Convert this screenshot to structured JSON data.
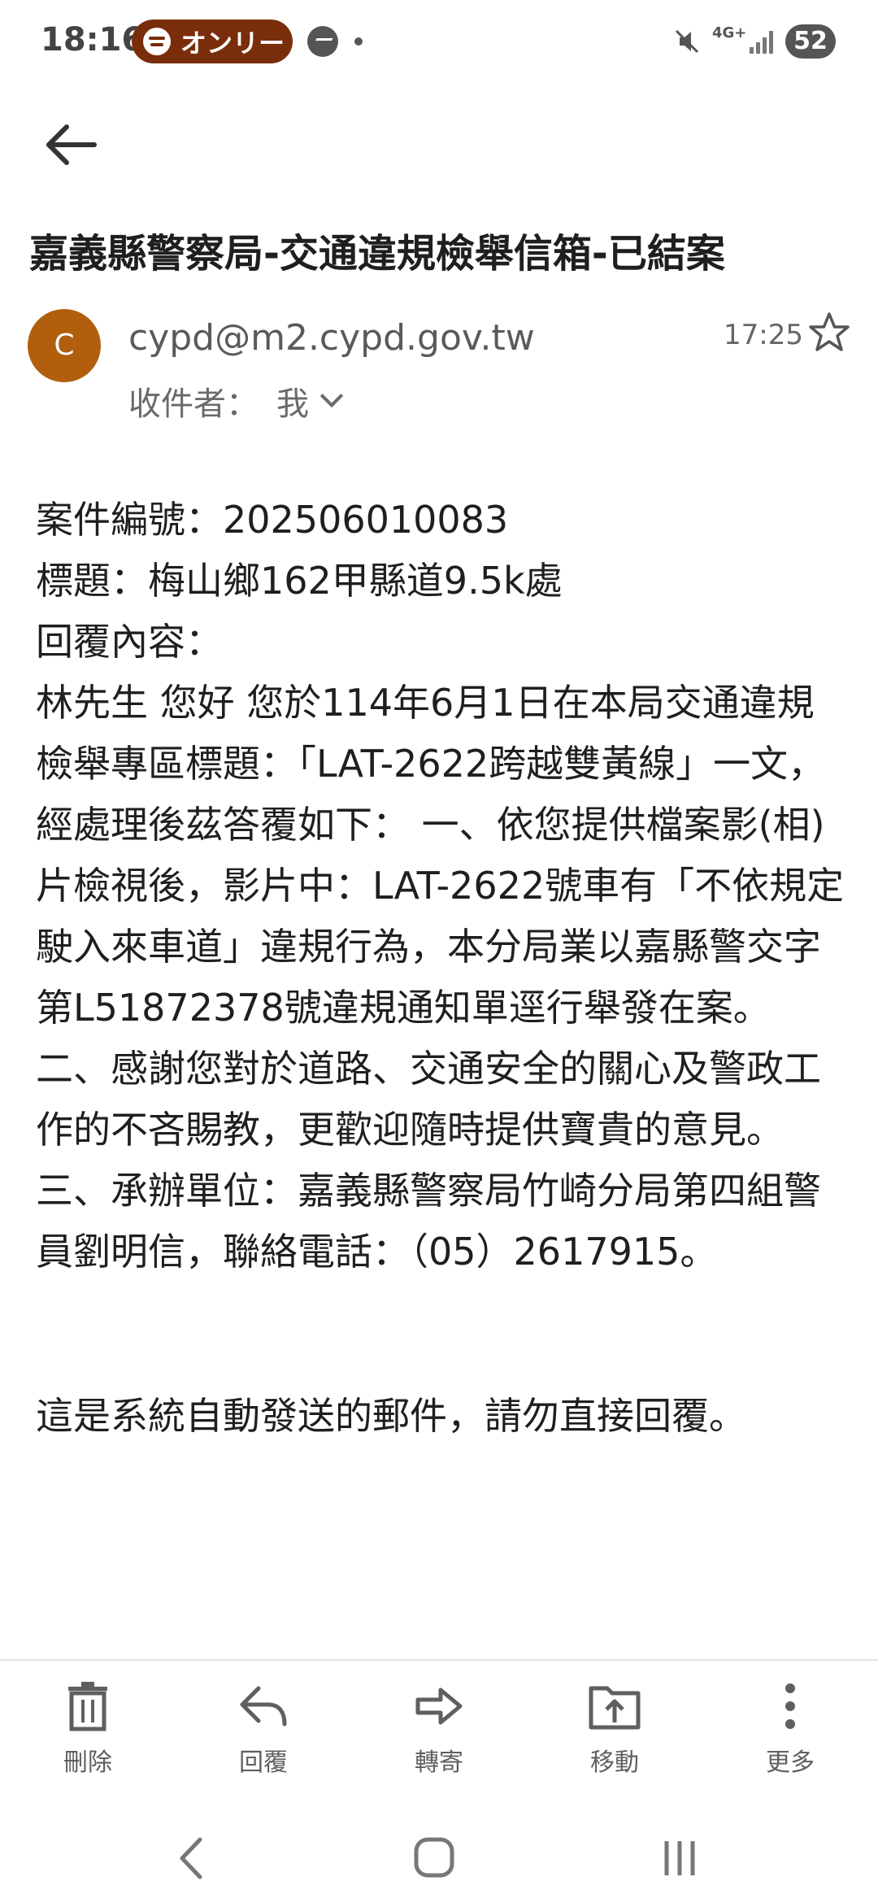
{
  "status_bar": {
    "time": "18:16",
    "spotify_label": "オンリー",
    "network": "4G+",
    "battery": "52"
  },
  "email": {
    "subject": "嘉義縣警察局-交通違規檢舉信箱-已結案",
    "avatar_letter": "C",
    "avatar_color": "#b15f0d",
    "sender": "cypd@m2.cypd.gov.tw",
    "recipient_label": "收件者：",
    "recipient": "我",
    "time": "17:25",
    "body_lines": [
      "案件編號：202506010083",
      "標題：梅山鄉162甲縣道9.5k處",
      "回覆內容：",
      "林先生 您好 您於114年6月1日在本局交通違規檢舉專區標題：「LAT-2622跨越雙黃線」一文，經處理後茲答覆如下： 一、依您提供檔案影(相)片檢視後，影片中：LAT-2622號車有「不依規定駛入來車道」違規行為，本分局業以嘉縣警交字第L51872378號違規通知單逕行舉發在案。 二、感謝您對於道路、交通安全的關心及警政工作的不吝賜教，更歡迎隨時提供寶貴的意見。 三、承辦單位：嘉義縣警察局竹崎分局第四組警員劉明信，聯絡電話：（05）2617915。"
    ],
    "footer": "這是系統自動發送的郵件，請勿直接回覆。"
  },
  "toolbar": {
    "delete": "刪除",
    "reply": "回覆",
    "forward": "轉寄",
    "move": "移動",
    "more": "更多"
  }
}
